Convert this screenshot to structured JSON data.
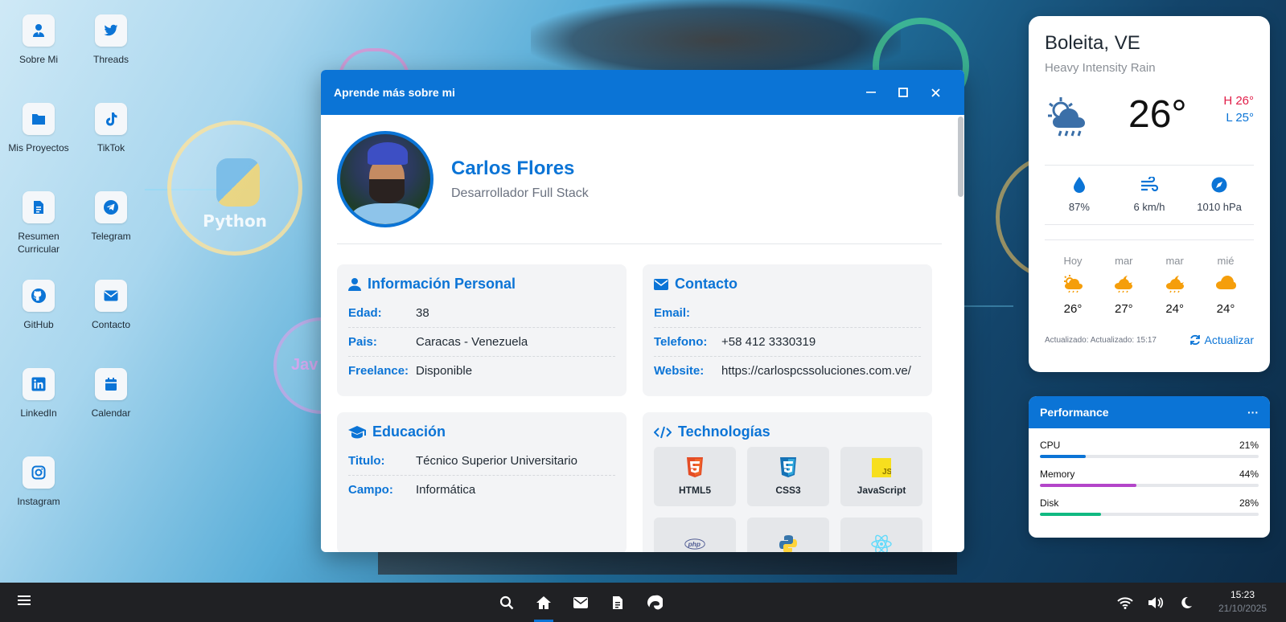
{
  "desktop": {
    "icons": [
      {
        "label": "Sobre Mi",
        "icon": "user-tie-icon"
      },
      {
        "label": "Threads",
        "icon": "twitter-icon"
      },
      {
        "label": "Mis Proyectos",
        "icon": "folder-icon"
      },
      {
        "label": "TikTok",
        "icon": "tiktok-icon"
      },
      {
        "label": "Resumen Curricular",
        "icon": "document-icon"
      },
      {
        "label": "Telegram",
        "icon": "telegram-icon"
      },
      {
        "label": "GitHub",
        "icon": "github-icon"
      },
      {
        "label": "Contacto",
        "icon": "envelope-icon"
      },
      {
        "label": "LinkedIn",
        "icon": "linkedin-icon"
      },
      {
        "label": "Calendar",
        "icon": "calendar-icon"
      },
      {
        "label": "Instagram",
        "icon": "instagram-icon"
      }
    ],
    "background_text": {
      "python": "Python",
      "java": "Jav"
    }
  },
  "window": {
    "title": "Aprende más sobre mi",
    "profile": {
      "name": "Carlos Flores",
      "role": "Desarrollador Full Stack"
    },
    "personal": {
      "title": "Información Personal",
      "rows": [
        {
          "key": "Edad:",
          "value": "38"
        },
        {
          "key": "Pais:",
          "value": "Caracas - Venezuela"
        },
        {
          "key": "Freelance:",
          "value": "Disponible"
        }
      ]
    },
    "contact": {
      "title": "Contacto",
      "rows": [
        {
          "key": "Email:",
          "value": ""
        },
        {
          "key": "Telefono:",
          "value": "+58 412 3330319"
        },
        {
          "key": "Website:",
          "value": "https://carlospcssoluciones.com.ve/"
        }
      ]
    },
    "education": {
      "title": "Educación",
      "rows": [
        {
          "key": "Titulo:",
          "value": "Técnico Superior Universitario"
        },
        {
          "key": "Campo:",
          "value": "Informática"
        }
      ]
    },
    "tech": {
      "title": "Technologías",
      "items": [
        {
          "label": "HTML5",
          "icon": "html5-icon"
        },
        {
          "label": "CSS3",
          "icon": "css3-icon"
        },
        {
          "label": "JavaScript",
          "icon": "javascript-icon"
        },
        {
          "label": "",
          "icon": "php-icon",
          "logo_text": "php"
        },
        {
          "label": "",
          "icon": "python-icon"
        },
        {
          "label": "",
          "icon": "react-icon"
        }
      ]
    }
  },
  "weather": {
    "city": "Boleita, VE",
    "condition": "Heavy Intensity Rain",
    "temp": "26°",
    "high": "H 26°",
    "low": "L 25°",
    "humidity": "87%",
    "wind": "6 km/h",
    "pressure": "1010 hPa",
    "forecast": [
      {
        "day": "Hoy",
        "temp": "26°"
      },
      {
        "day": "mar",
        "temp": "27°"
      },
      {
        "day": "mar",
        "temp": "24°"
      },
      {
        "day": "mié",
        "temp": "24°"
      }
    ],
    "updated": "Actualizado: Actualizado: 15:17",
    "refresh_label": "Actualizar"
  },
  "performance": {
    "title": "Performance",
    "menu": "···",
    "metrics": [
      {
        "name": "CPU",
        "value": "21%",
        "fraction": 0.21,
        "color": "#0b74d6"
      },
      {
        "name": "Memory",
        "value": "44%",
        "fraction": 0.44,
        "color": "#b345c9"
      },
      {
        "name": "Disk",
        "value": "28%",
        "fraction": 0.28,
        "color": "#10b981"
      }
    ]
  },
  "taskbar": {
    "time": "15:23",
    "date": "21/10/2025"
  },
  "colors": {
    "accent": "#0b74d6",
    "high": "#e11d48",
    "taskbar": "#202124"
  }
}
